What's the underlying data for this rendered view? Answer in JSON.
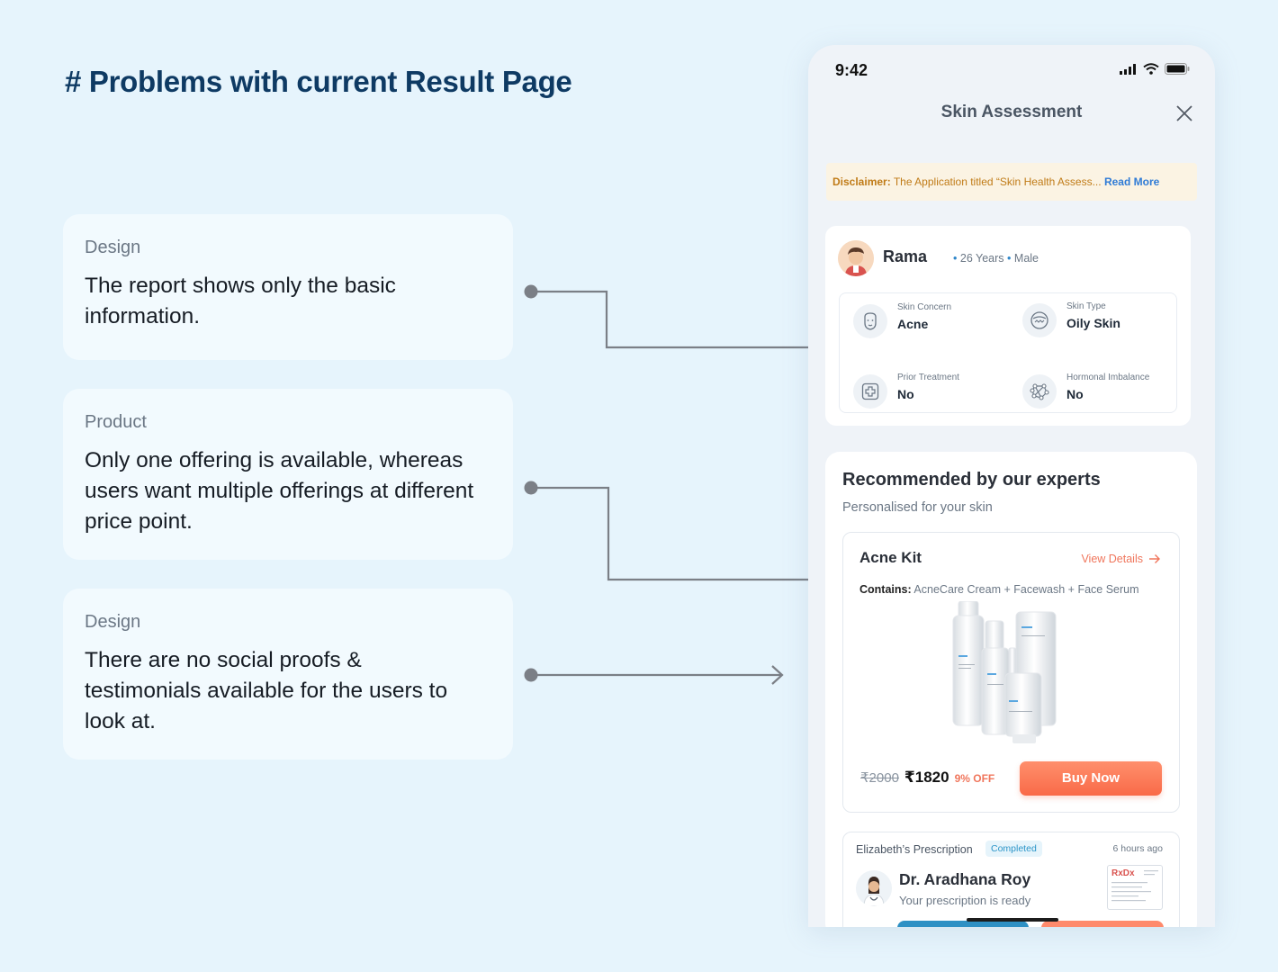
{
  "heading": "# Problems with current Result Page",
  "notes": [
    {
      "tag": "Design",
      "text": "The report shows only the basic information."
    },
    {
      "tag": "Product",
      "text": "Only one offering is available, whereas users want multiple offerings at different price point."
    },
    {
      "tag": "Design",
      "text": "There are no social proofs & testimonials available for the users to look at."
    }
  ],
  "phone": {
    "status": {
      "time": "9:42"
    },
    "header": {
      "title": "Skin Assessment"
    },
    "disclaimer": {
      "label": "Disclaimer:",
      "text": " The Application titled “Skin Health Assess...",
      "link": "Read More"
    },
    "profile": {
      "name": "Rama",
      "age": "26 Years",
      "gender": "Male",
      "stats": [
        {
          "label": "Skin Concern",
          "value": "Acne",
          "icon": "face-icon"
        },
        {
          "label": "Skin Type",
          "value": "Oily Skin",
          "icon": "skin-type-icon"
        },
        {
          "label": "Prior Treatment",
          "value": "No",
          "icon": "medical-cross-icon"
        },
        {
          "label": "Hormonal Imbalance",
          "value": "No",
          "icon": "molecule-icon"
        }
      ]
    },
    "recommendation": {
      "title": "Recommended by our experts",
      "subtitle": "Personalised for your skin",
      "kit": {
        "name": "Acne Kit",
        "view_details": "View Details",
        "contains_label": "Contains:",
        "contains_text": " AcneCare Cream + Facewash + Face Serum",
        "old_price": "₹2000",
        "new_price": "₹1820",
        "discount": "9% OFF",
        "buy_label": "Buy Now"
      },
      "prescription": {
        "title": "Elizabeth’s Prescription",
        "badge": "Completed",
        "time": "6 hours ago",
        "doctor": "Dr. Aradhana Roy",
        "status": "Your prescription is ready",
        "thumb_logo": "RxDx"
      }
    }
  },
  "colors": {
    "accent": "#f96a48",
    "heading": "#0e3a63",
    "link": "#2f7bd6",
    "background": "#e6f4fc"
  }
}
